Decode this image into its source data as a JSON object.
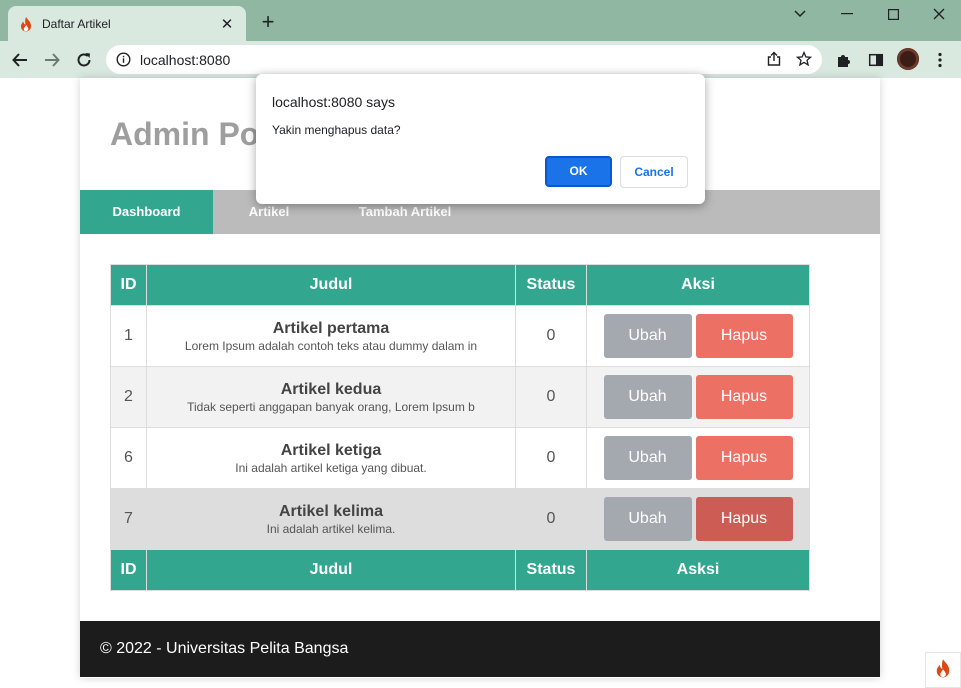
{
  "browser": {
    "tab_title": "Daftar Artikel",
    "tab_close": "✕",
    "new_tab": "+",
    "url": "localhost:8080",
    "window_controls": {
      "dropdown": "⌄",
      "minimize": "—",
      "maximize": "☐",
      "close": "✕"
    }
  },
  "page": {
    "site_title": "Admin Portal",
    "nav": [
      {
        "label": "Dashboard",
        "active": true
      },
      {
        "label": "Artikel",
        "active": false
      },
      {
        "label": "Tambah Artikel",
        "active": false
      }
    ],
    "table": {
      "headers": [
        "ID",
        "Judul",
        "Status",
        "Aksi"
      ],
      "footer_headers": [
        "ID",
        "Judul",
        "Status",
        "Asksi"
      ],
      "rows": [
        {
          "id": "1",
          "title": "Artikel pertama",
          "excerpt": "Lorem Ipsum adalah contoh teks atau dummy dalam in",
          "status": "0",
          "edit": "Ubah",
          "delete": "Hapus"
        },
        {
          "id": "2",
          "title": "Artikel kedua",
          "excerpt": "Tidak seperti anggapan banyak orang, Lorem Ipsum b",
          "status": "0",
          "edit": "Ubah",
          "delete": "Hapus"
        },
        {
          "id": "6",
          "title": "Artikel ketiga",
          "excerpt": "Ini adalah artikel ketiga yang dibuat.",
          "status": "0",
          "edit": "Ubah",
          "delete": "Hapus"
        },
        {
          "id": "7",
          "title": "Artikel kelima",
          "excerpt": "Ini adalah artikel kelima.",
          "status": "0",
          "edit": "Ubah",
          "delete": "Hapus"
        }
      ]
    },
    "footer": "© 2022 - Universitas Pelita Bangsa"
  },
  "dialog": {
    "title": "localhost:8080 says",
    "message": "Yakin menghapus data?",
    "ok_label": "OK",
    "cancel_label": "Cancel"
  },
  "colors": {
    "accent": "#33a690",
    "nav_bg": "#bbbbbb",
    "edit_button": "#a3a9af",
    "delete_button": "#ec7063",
    "footer_bg": "#1c1c1c",
    "dialog_ok": "#1a73e8"
  },
  "icons": {
    "favicon": "codeigniter-flame-icon",
    "back": "arrow-left-icon",
    "forward": "arrow-right-icon",
    "reload": "reload-icon",
    "site_info": "info-icon",
    "share": "share-icon",
    "bookmark": "star-icon",
    "extensions": "puzzle-icon",
    "side_panel": "side-panel-icon",
    "menu": "kebab-menu-icon"
  }
}
